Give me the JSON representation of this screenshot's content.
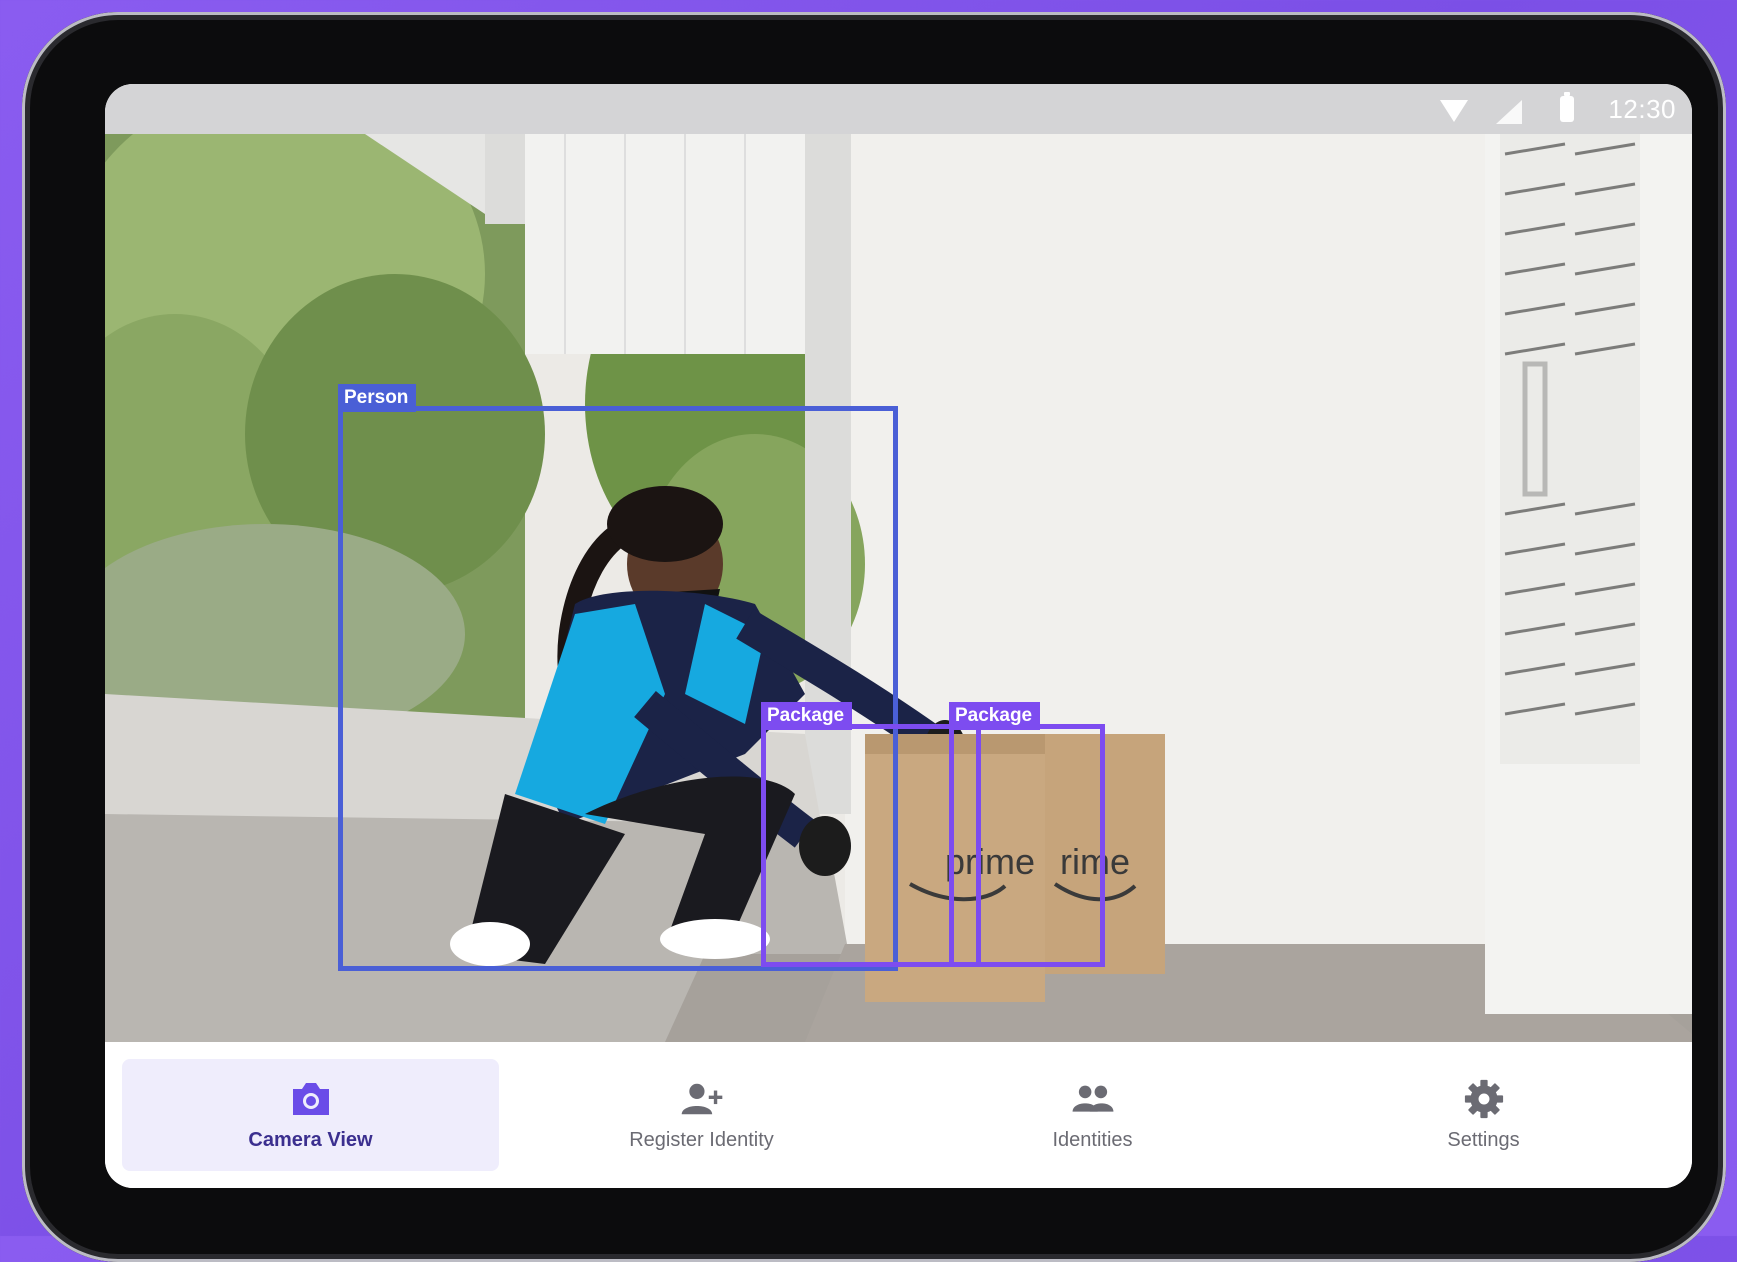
{
  "status_bar": {
    "time": "12:30",
    "icons": [
      "wifi-icon",
      "signal-icon",
      "battery-icon"
    ]
  },
  "camera_view": {
    "detections": [
      {
        "label": "Person",
        "color": "#4a5fd6"
      },
      {
        "label": "Package",
        "color": "#7d4cf0"
      },
      {
        "label": "Package",
        "color": "#7d4cf0"
      }
    ]
  },
  "nav": {
    "items": [
      {
        "label": "Camera View",
        "icon": "camera-icon",
        "active": true
      },
      {
        "label": "Register Identity",
        "icon": "person-add-icon",
        "active": false
      },
      {
        "label": "Identities",
        "icon": "people-icon",
        "active": false
      },
      {
        "label": "Settings",
        "icon": "gear-icon",
        "active": false
      }
    ]
  },
  "colors": {
    "accent": "#6a4ce8",
    "background": "#8a5cf0",
    "person_box": "#4a5fd6",
    "package_box": "#7d4cf0"
  }
}
